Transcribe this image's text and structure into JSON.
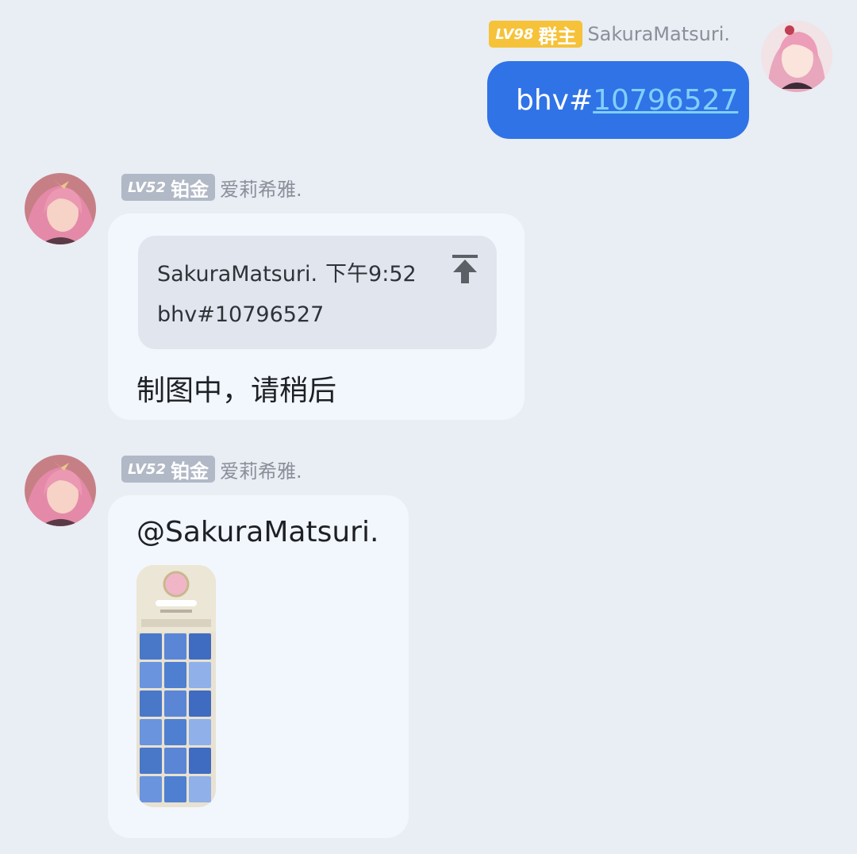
{
  "messages": [
    {
      "direction": "outgoing",
      "sender": {
        "level": "LV98",
        "role": "群主",
        "name": "SakuraMatsuri."
      },
      "text_prefix": "bhv#",
      "text_link": "10796527"
    },
    {
      "direction": "incoming",
      "sender": {
        "level": "LV52",
        "role": "铂金",
        "name": "爱莉希雅."
      },
      "reply": {
        "author": "SakuraMatsuri.",
        "time": "下午9:52",
        "text": "bhv#10796527",
        "icon": "jump-to-original-icon"
      },
      "text": "制图中，请稍后"
    },
    {
      "direction": "incoming",
      "sender": {
        "level": "LV52",
        "role": "铂金",
        "name": "爱莉希雅."
      },
      "mention": "@SakuraMatsuri.",
      "attachment": "image-thumbnail"
    }
  ],
  "colors": {
    "background": "#e9edf4",
    "self_bubble": "#2f73e6",
    "link": "#7fd0ff",
    "other_bubble": "#f2f6fd",
    "owner_badge": "#f6c23a",
    "member_badge": "#b1b8c6"
  }
}
